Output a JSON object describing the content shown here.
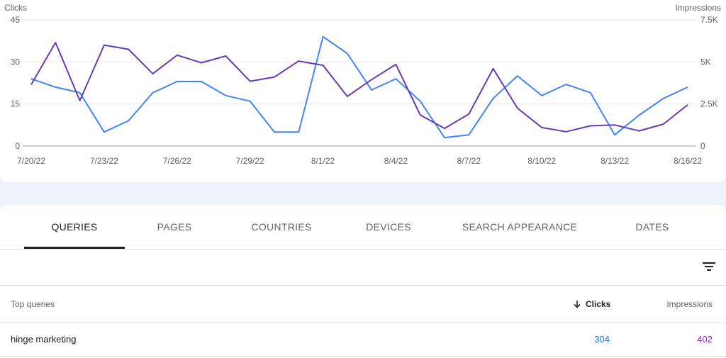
{
  "chart_data": {
    "type": "line",
    "x": [
      "7/20/22",
      "7/21/22",
      "7/22/22",
      "7/23/22",
      "7/24/22",
      "7/25/22",
      "7/26/22",
      "7/27/22",
      "7/28/22",
      "7/29/22",
      "7/30/22",
      "7/31/22",
      "8/1/22",
      "8/2/22",
      "8/3/22",
      "8/4/22",
      "8/5/22",
      "8/6/22",
      "8/7/22",
      "8/8/22",
      "8/9/22",
      "8/10/22",
      "8/11/22",
      "8/12/22",
      "8/13/22",
      "8/14/22",
      "8/15/22",
      "8/16/22"
    ],
    "x_tick_labels": [
      "7/20/22",
      "7/23/22",
      "7/26/22",
      "7/29/22",
      "8/1/22",
      "8/4/22",
      "8/7/22",
      "8/10/22",
      "8/13/22",
      "8/16/22"
    ],
    "series": [
      {
        "name": "Clicks",
        "axis": "left",
        "color": "#4285f4",
        "values": [
          24,
          21,
          19,
          5,
          9,
          19,
          23,
          23,
          18,
          16,
          5,
          5,
          39,
          33,
          20,
          24,
          16,
          3,
          4,
          17,
          25,
          18,
          22,
          19,
          4,
          11,
          17,
          21
        ]
      },
      {
        "name": "Impressions",
        "axis": "right",
        "color": "#673ab7",
        "values": [
          3650,
          6150,
          2700,
          6000,
          5750,
          4300,
          5400,
          4950,
          5350,
          3850,
          4100,
          5050,
          4800,
          2950,
          3950,
          4850,
          1850,
          1050,
          1900,
          4600,
          2250,
          1100,
          850,
          1200,
          1250,
          900,
          1300,
          2450
        ]
      }
    ],
    "left_axis": {
      "label": "Clicks",
      "ticks": [
        "0",
        "15",
        "30",
        "45"
      ],
      "ylim": [
        0,
        45
      ]
    },
    "right_axis": {
      "label": "Impressions",
      "ticks": [
        "0",
        "2.5K",
        "5K",
        "7.5K"
      ],
      "ylim": [
        0,
        7500
      ]
    },
    "grid": true
  },
  "tabs": [
    "QUERIES",
    "PAGES",
    "COUNTRIES",
    "DEVICES",
    "SEARCH APPEARANCE",
    "DATES"
  ],
  "active_tab": "QUERIES",
  "table": {
    "headers": {
      "query": "Top queries",
      "clicks": "Clicks",
      "impressions": "Impressions"
    },
    "sort_icon": "arrow-down-icon",
    "rows": [
      {
        "query": "hinge marketing",
        "clicks": "304",
        "impressions": "402"
      }
    ]
  },
  "filter_icon": "filter-icon"
}
